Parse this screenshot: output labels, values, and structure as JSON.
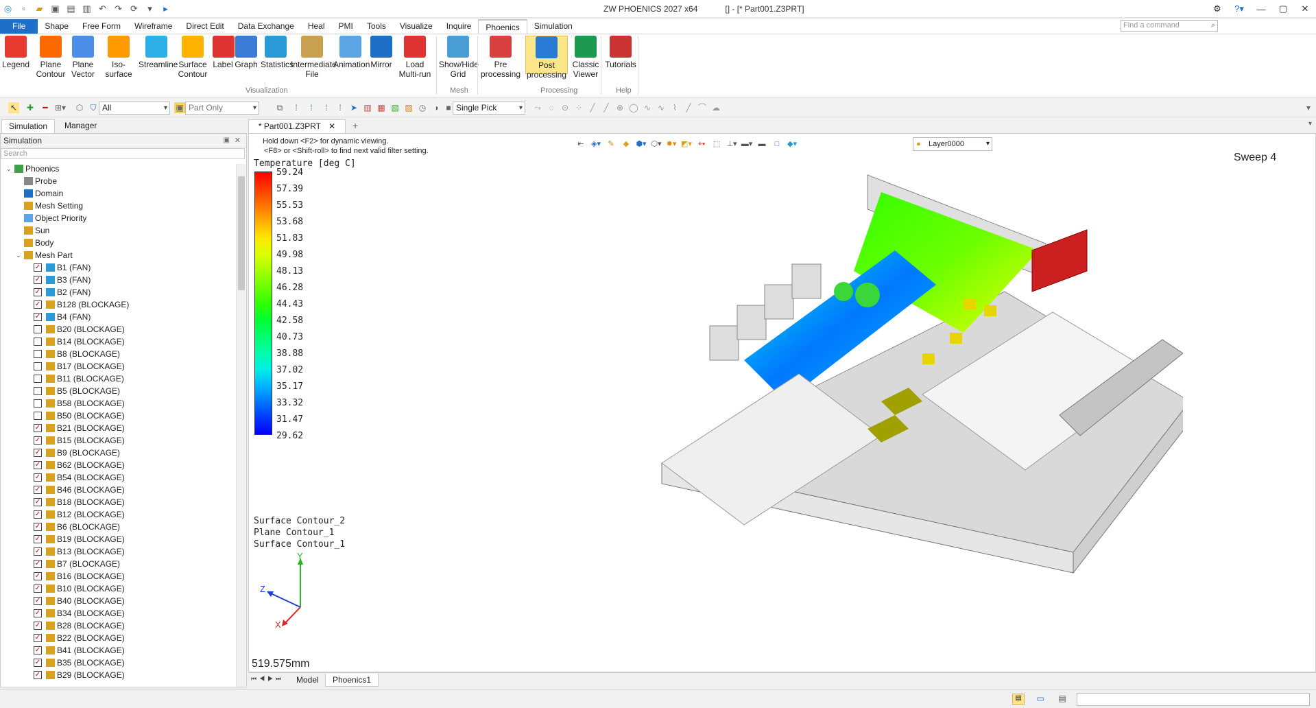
{
  "window": {
    "title": "ZW PHOENICS 2027 x64",
    "doc": "[] - [* Part001.Z3PRT]"
  },
  "command_placeholder": "Find a command",
  "menu": [
    "File",
    "Shape",
    "Free Form",
    "Wireframe",
    "Direct Edit",
    "Data Exchange",
    "Heal",
    "PMI",
    "Tools",
    "Visualize",
    "Inquire",
    "Phoenics",
    "Simulation"
  ],
  "ribbon": {
    "buttons": [
      "Legend",
      "Plane Contour",
      "Plane Vector",
      "Iso-surface",
      "Streamline",
      "Surface Contour",
      "Label",
      "Graph",
      "Statistics",
      "Intermediate File",
      "Animation",
      "Mirror",
      "Load Multi-run",
      "Show/Hide Grid",
      "Pre processing",
      "Post processing",
      "Classic Viewer",
      "Tutorials"
    ],
    "groups": [
      "Visualization",
      "Mesh",
      "Processing",
      "Help"
    ]
  },
  "toolbar2": {
    "filter": "All",
    "scope": "Part Only",
    "pick": "Single Pick"
  },
  "left_tabs": [
    "Simulation",
    "Manager"
  ],
  "panel": {
    "title": "Simulation",
    "search": "Search"
  },
  "tree": {
    "root": "Phoenics",
    "items": [
      "Probe",
      "Domain",
      "Mesh Setting",
      "Object Priority",
      "Sun",
      "Body",
      "Mesh Part"
    ],
    "parts": [
      {
        "label": "B1 (FAN)",
        "checked": true,
        "fan": true
      },
      {
        "label": "B3 (FAN)",
        "checked": true,
        "fan": true
      },
      {
        "label": "B2 (FAN)",
        "checked": true,
        "fan": true
      },
      {
        "label": "B128 (BLOCKAGE)",
        "checked": true
      },
      {
        "label": "B4 (FAN)",
        "checked": true,
        "fan": true
      },
      {
        "label": "B20 (BLOCKAGE)",
        "checked": false
      },
      {
        "label": "B14 (BLOCKAGE)",
        "checked": false
      },
      {
        "label": "B8 (BLOCKAGE)",
        "checked": false
      },
      {
        "label": "B17 (BLOCKAGE)",
        "checked": false
      },
      {
        "label": "B11 (BLOCKAGE)",
        "checked": false
      },
      {
        "label": "B5 (BLOCKAGE)",
        "checked": false
      },
      {
        "label": "B58 (BLOCKAGE)",
        "checked": false
      },
      {
        "label": "B50 (BLOCKAGE)",
        "checked": false
      },
      {
        "label": "B21 (BLOCKAGE)",
        "checked": true
      },
      {
        "label": "B15 (BLOCKAGE)",
        "checked": true
      },
      {
        "label": "B9 (BLOCKAGE)",
        "checked": true
      },
      {
        "label": "B62 (BLOCKAGE)",
        "checked": true
      },
      {
        "label": "B54 (BLOCKAGE)",
        "checked": true
      },
      {
        "label": "B46 (BLOCKAGE)",
        "checked": true
      },
      {
        "label": "B18 (BLOCKAGE)",
        "checked": true
      },
      {
        "label": "B12 (BLOCKAGE)",
        "checked": true
      },
      {
        "label": "B6 (BLOCKAGE)",
        "checked": true
      },
      {
        "label": "B19 (BLOCKAGE)",
        "checked": true
      },
      {
        "label": "B13 (BLOCKAGE)",
        "checked": true
      },
      {
        "label": "B7 (BLOCKAGE)",
        "checked": true
      },
      {
        "label": "B16 (BLOCKAGE)",
        "checked": true
      },
      {
        "label": "B10 (BLOCKAGE)",
        "checked": true
      },
      {
        "label": "B40 (BLOCKAGE)",
        "checked": true
      },
      {
        "label": "B34 (BLOCKAGE)",
        "checked": true
      },
      {
        "label": "B28 (BLOCKAGE)",
        "checked": true
      },
      {
        "label": "B22 (BLOCKAGE)",
        "checked": true
      },
      {
        "label": "B41 (BLOCKAGE)",
        "checked": true
      },
      {
        "label": "B35 (BLOCKAGE)",
        "checked": true
      },
      {
        "label": "B29 (BLOCKAGE)",
        "checked": true
      }
    ]
  },
  "doc_tab": "* Part001.Z3PRT",
  "viewport": {
    "hint1": "Hold down <F2> for dynamic viewing.",
    "hint2": "<F8> or <Shift-roll> to find next valid filter setting.",
    "layer": "Layer0000",
    "sweep": "Sweep 4",
    "legend_title": "Temperature [deg C]",
    "legend_values": [
      "59.24",
      "57.39",
      "55.53",
      "53.68",
      "51.83",
      "49.98",
      "48.13",
      "46.28",
      "44.43",
      "42.58",
      "40.73",
      "38.88",
      "37.02",
      "35.17",
      "33.32",
      "31.47",
      "29.62"
    ],
    "legend_colors": [
      "#ff0000",
      "#ff3a00",
      "#ff7300",
      "#ffae00",
      "#ffe800",
      "#dcff00",
      "#a6ff00",
      "#6cff00",
      "#33ff00",
      "#00ff34",
      "#00ff6c",
      "#00ffaa",
      "#00f0e6",
      "#00b8ff",
      "#0078ff",
      "#0038ff",
      "#0000ff"
    ],
    "layers": [
      "Surface Contour_2",
      "Plane Contour_1",
      "Surface Contour_1"
    ],
    "axes": {
      "x": "X",
      "y": "Y",
      "z": "Z"
    },
    "scale": "519.575mm"
  },
  "bottom_tabs": [
    "Model",
    "Phoenics1"
  ]
}
